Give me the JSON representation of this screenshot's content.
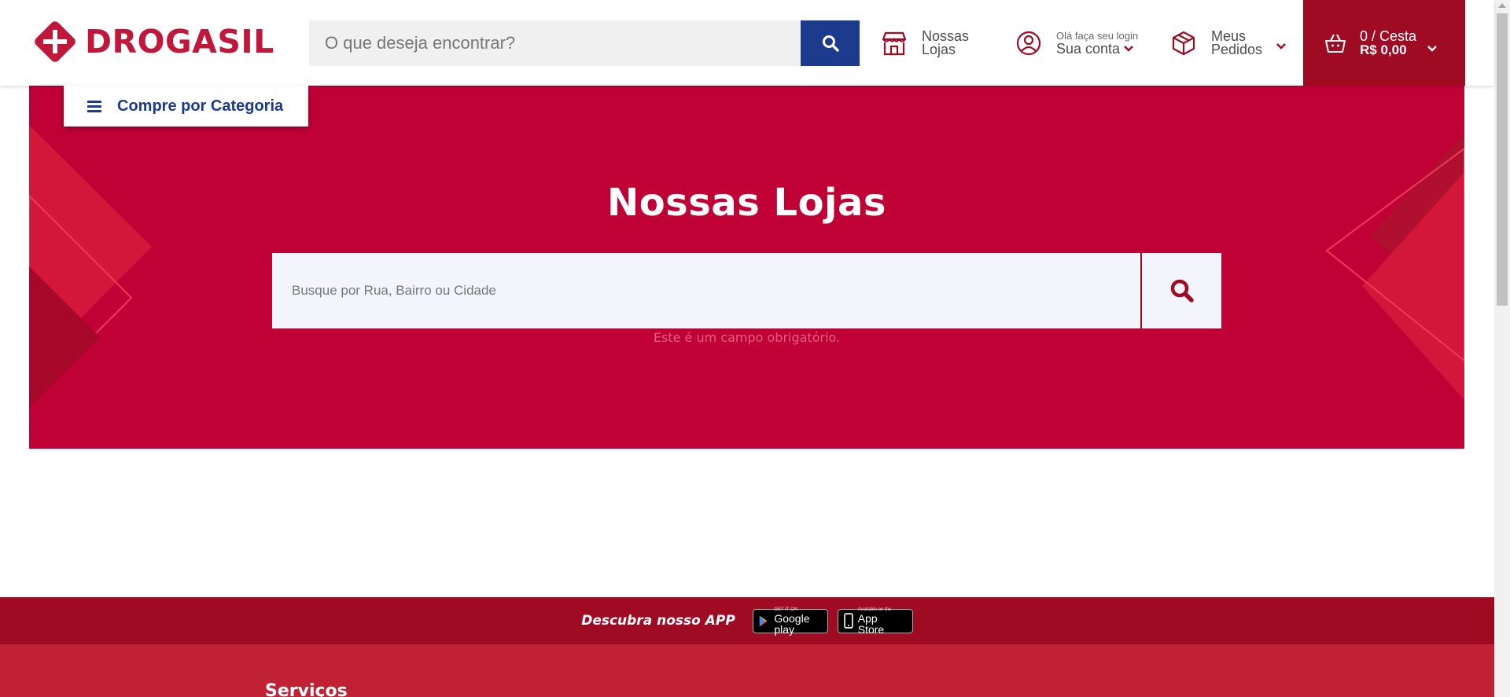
{
  "header": {
    "logo_text": "DROGASIL",
    "search_placeholder": "O que deseja encontrar?",
    "stores_line1": "Nossas",
    "stores_line2": "Lojas",
    "account_greeting": "Olá faça seu login",
    "account_label": "Sua conta",
    "orders_line1": "Meus",
    "orders_line2": "Pedidos",
    "cart_line1": "0 / Cesta",
    "cart_line2": "R$ 0,00"
  },
  "category": {
    "label": "Compre por Categoria"
  },
  "hero": {
    "title": "Nossas Lojas",
    "search_placeholder": "Busque por Rua, Bairro ou Cidade",
    "required_message": "Este é um campo obrigatório."
  },
  "app_strip": {
    "text": "Descubra nosso APP",
    "google_small": "GET IT ON",
    "google_big": "Google play",
    "apple_small": "Available on the",
    "apple_big": "App Store"
  },
  "footer": {
    "title": "Serviços"
  },
  "colors": {
    "brand_red": "#c1173a",
    "hero_red": "#bf0135",
    "dark_red": "#a00b24",
    "brand_blue": "#1c3a8e"
  },
  "icons": {
    "logo": "cross-diamond-icon",
    "search": "search-icon",
    "stores": "store-icon",
    "account": "user-circle-icon",
    "orders": "box-icon",
    "cart": "basket-icon",
    "menu": "menu-icon"
  }
}
